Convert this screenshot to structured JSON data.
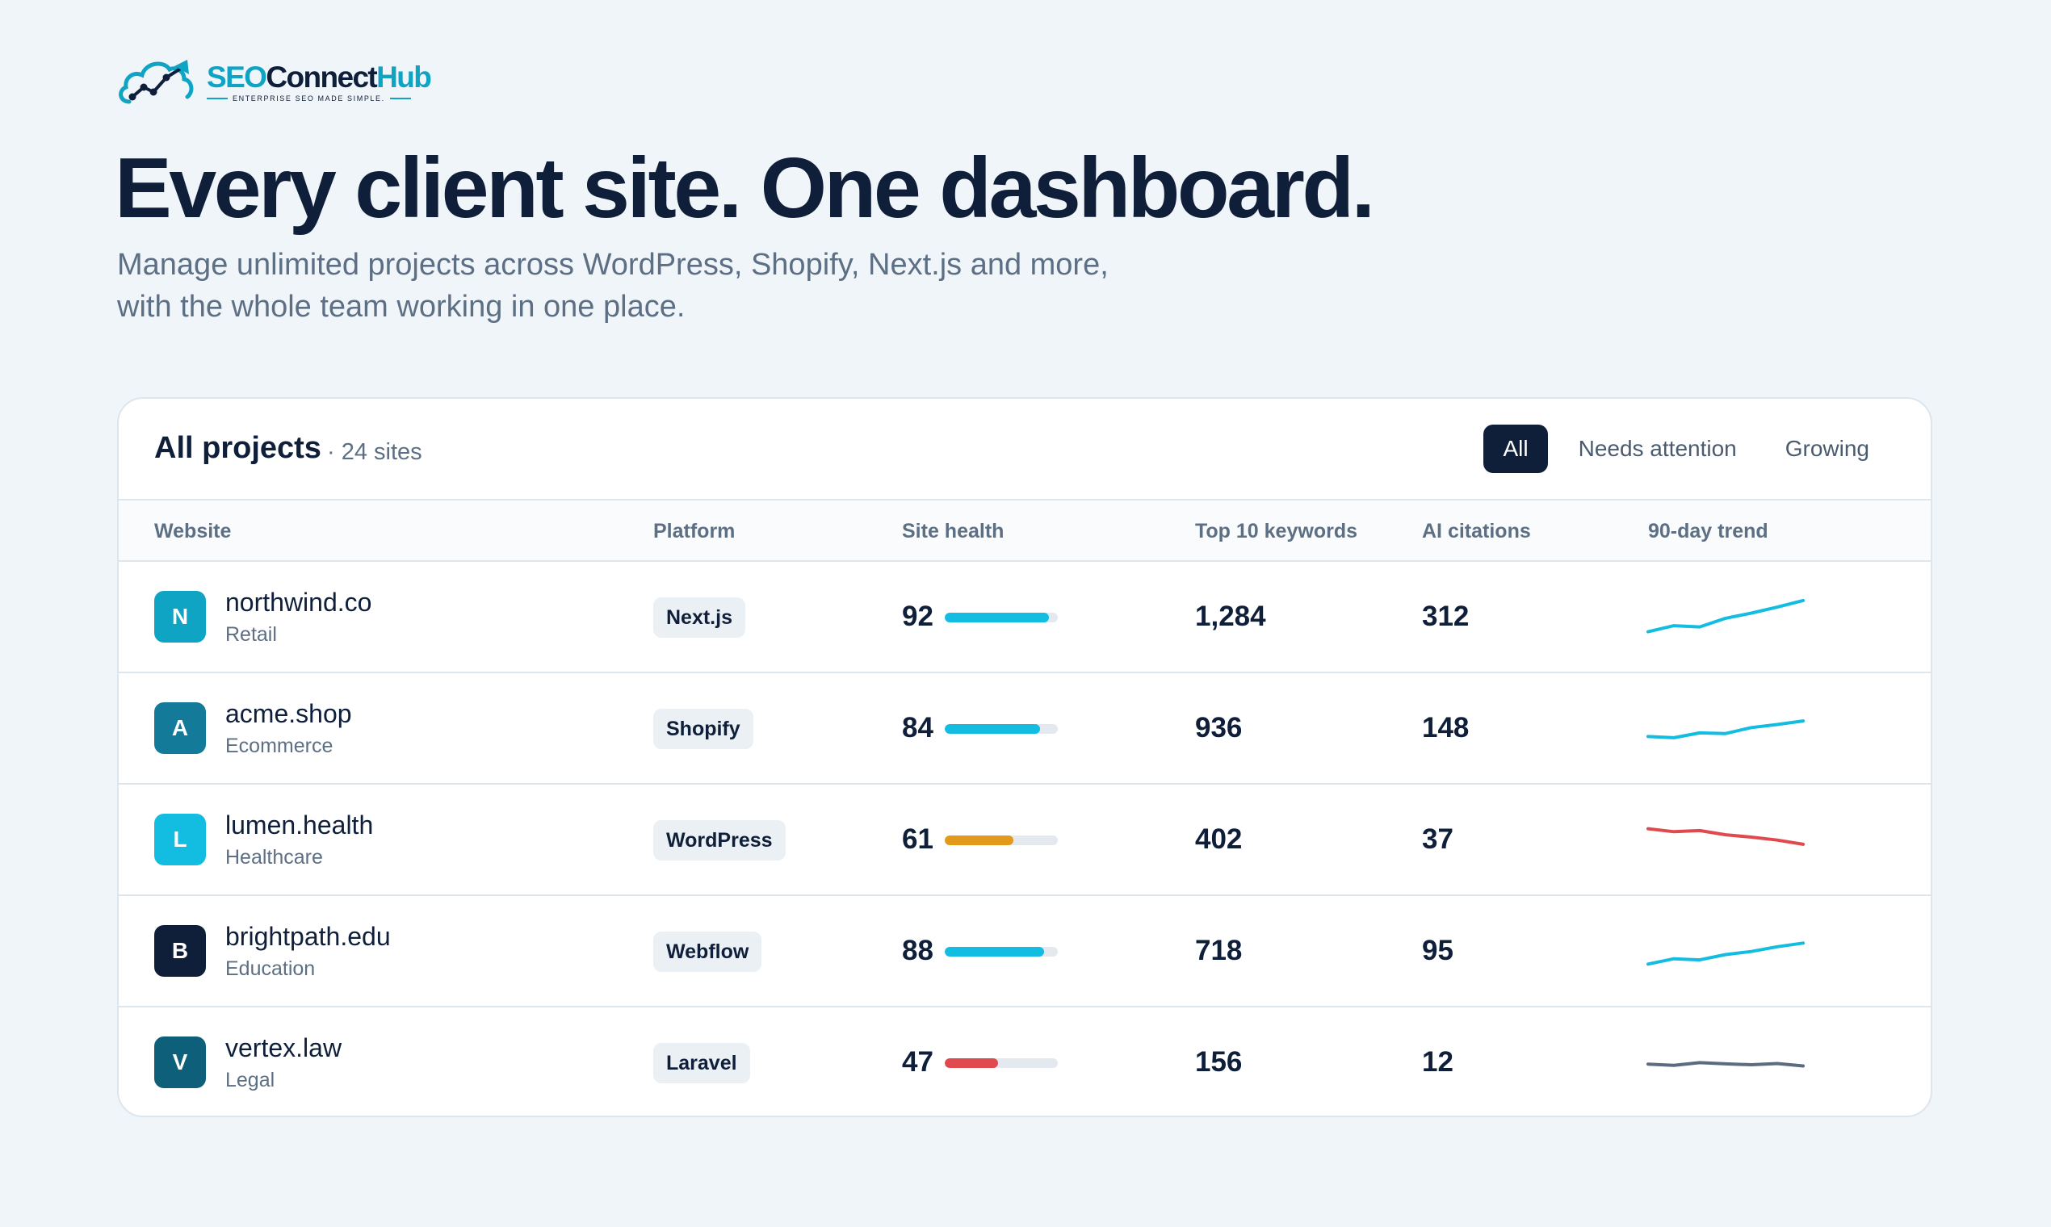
{
  "brand": {
    "name_seo": "SEO",
    "name_connect": "Connect",
    "name_hub": "Hub",
    "tagline": "ENTERPRISE SEO MADE SIMPLE.",
    "logo_icon": "cloud-chart-icon",
    "accent_color": "#0fa3c4"
  },
  "hero": {
    "title": "Every client site. One dashboard.",
    "subtitle_line1": "Manage unlimited projects across WordPress, Shopify, Next.js and more,",
    "subtitle_line2": "with the whole team working in one place."
  },
  "projects": {
    "title": "All projects",
    "count": "· 24 sites",
    "filters": [
      {
        "label": "All",
        "active": true
      },
      {
        "label": "Needs attention",
        "active": false
      },
      {
        "label": "Growing",
        "active": false
      }
    ],
    "columns": {
      "website": "Website",
      "platform": "Platform",
      "health": "Site health",
      "keywords": "Top 10 keywords",
      "citations": "AI citations",
      "trend": "90-day trend"
    },
    "rows": [
      {
        "initial": "N",
        "avatar_color": "#0fa3c4",
        "site": "northwind.co",
        "category": "Retail",
        "platform": "Next.js",
        "health": "92",
        "health_value": 92,
        "health_color": "#13bde2",
        "keywords": "1,284",
        "citations": "312",
        "trend_color": "#13bde2",
        "trend": [
          2,
          4,
          3.6,
          6.5,
          8.2,
          10.2,
          12.4
        ]
      },
      {
        "initial": "A",
        "avatar_color": "#147a99",
        "site": "acme.shop",
        "category": "Ecommerce",
        "platform": "Shopify",
        "health": "84",
        "health_value": 84,
        "health_color": "#13bde2",
        "keywords": "936",
        "citations": "148",
        "trend_color": "#13bde2",
        "trend": [
          4.2,
          3.8,
          5.4,
          5.2,
          7.2,
          8.2,
          9.4
        ]
      },
      {
        "initial": "L",
        "avatar_color": "#13bde2",
        "site": "lumen.health",
        "category": "Healthcare",
        "platform": "WordPress",
        "health": "61",
        "health_value": 61,
        "health_color": "#e39a1c",
        "keywords": "402",
        "citations": "37",
        "trend_color": "#e04a4f",
        "trend": [
          10.6,
          9.6,
          10,
          8.6,
          7.8,
          6.8,
          5.4
        ]
      },
      {
        "initial": "B",
        "avatar_color": "#0f1f3a",
        "site": "brightpath.edu",
        "category": "Education",
        "platform": "Webflow",
        "health": "88",
        "health_value": 88,
        "health_color": "#13bde2",
        "keywords": "718",
        "citations": "95",
        "trend_color": "#13bde2",
        "trend": [
          2.6,
          4.4,
          4,
          5.8,
          6.8,
          8.4,
          9.6
        ]
      },
      {
        "initial": "V",
        "avatar_color": "#0e5f7a",
        "site": "vertex.law",
        "category": "Legal",
        "platform": "Laravel",
        "health": "47",
        "health_value": 47,
        "health_color": "#e04a4f",
        "keywords": "156",
        "citations": "12",
        "trend_color": "#5b6b80",
        "trend": [
          6.4,
          6,
          6.9,
          6.5,
          6.2,
          6.6,
          5.8
        ]
      }
    ]
  }
}
